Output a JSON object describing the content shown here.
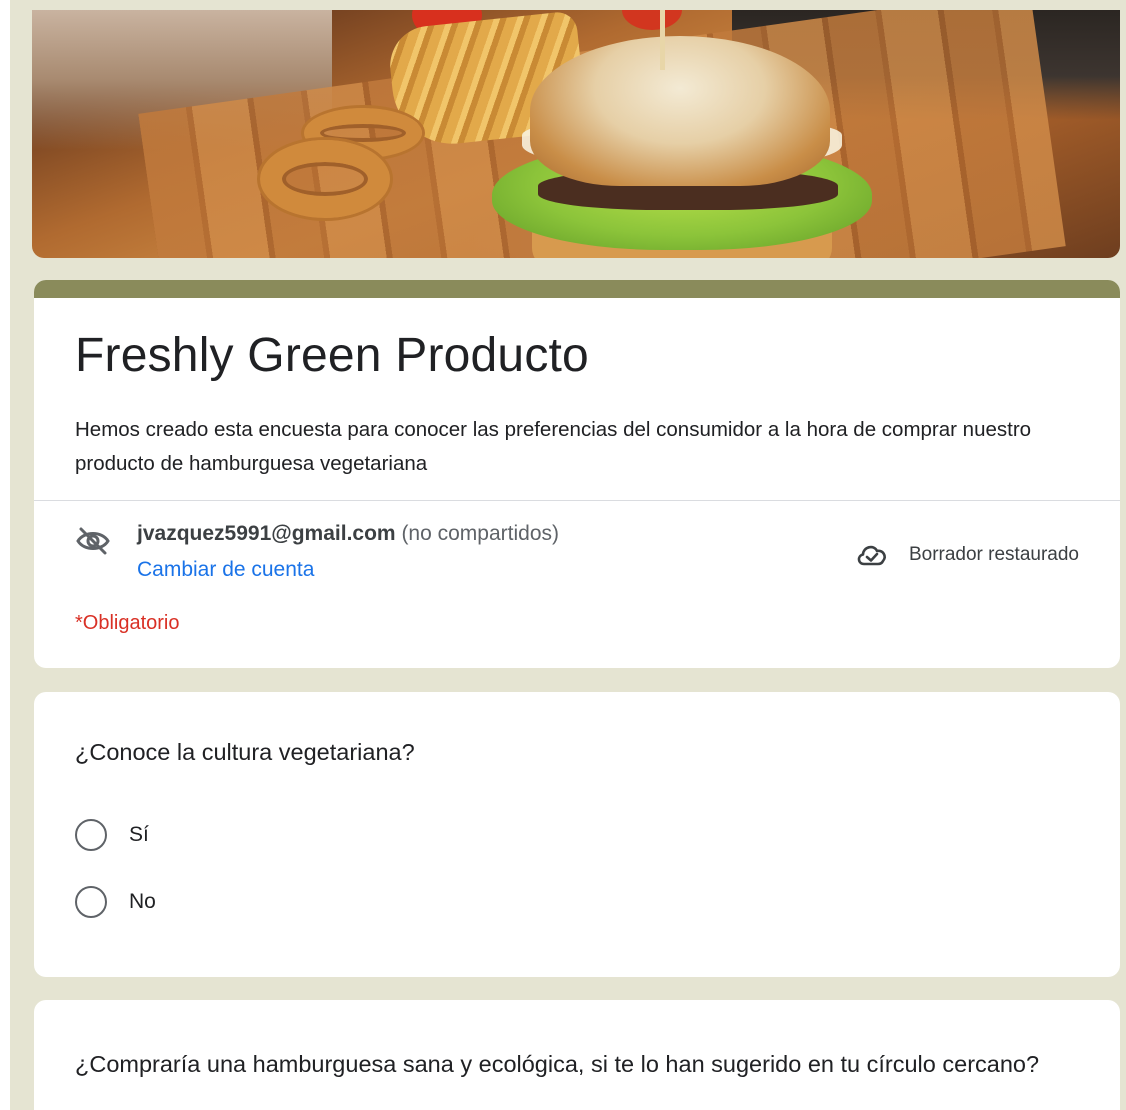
{
  "form": {
    "title": "Freshly Green Producto",
    "description": "Hemos creado esta encuesta para conocer las preferencias del consumidor a la hora de comprar nuestro producto de hamburguesa vegetariana",
    "accent_color": "#8a8b5b",
    "background_color": "#e5e4d2"
  },
  "account": {
    "email": "jvazquez5991@gmail.com",
    "sharing_note": "(no compartidos)",
    "switch_label": "Cambiar de cuenta",
    "visibility_icon": "eye-off-icon"
  },
  "draft": {
    "status_label": "Borrador restaurado",
    "icon": "cloud-check-icon"
  },
  "required_note": "*Obligatorio",
  "questions": [
    {
      "title": "¿Conoce la cultura vegetariana?",
      "options": [
        "Sí",
        "No"
      ]
    },
    {
      "title": "¿Compraría una hamburguesa sana y ecológica, si te lo han sugerido en tu círculo cercano?"
    }
  ]
}
